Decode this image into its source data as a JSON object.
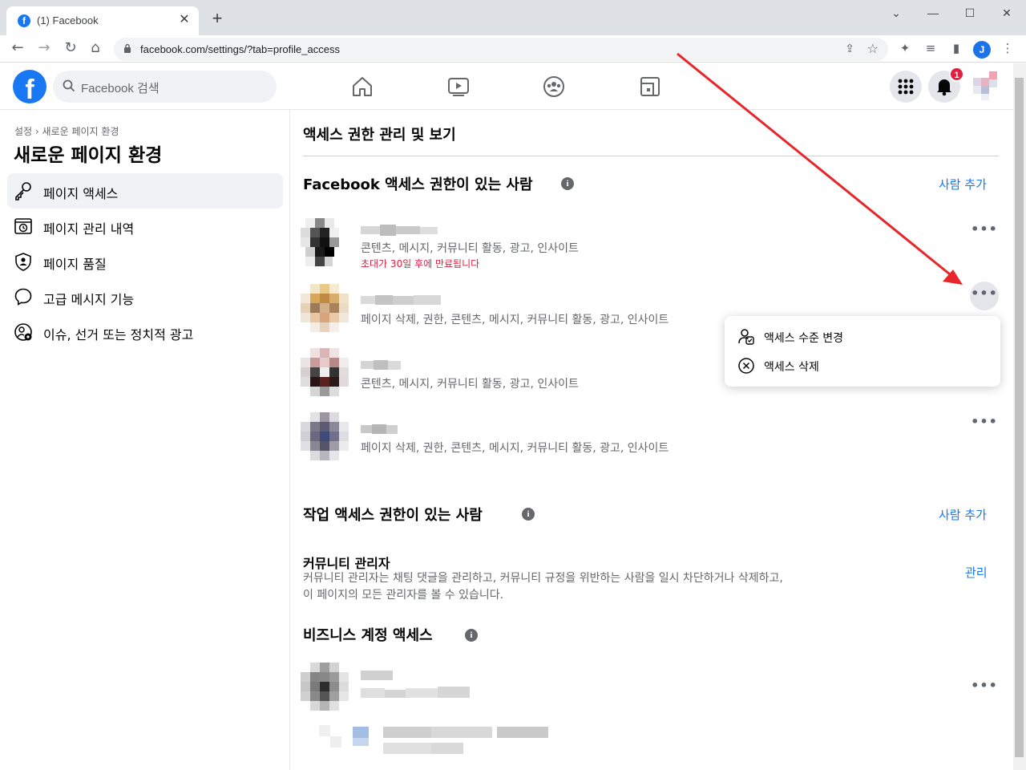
{
  "browser": {
    "tab_title": "(1) Facebook",
    "tab_close": "✕",
    "new_tab": "+",
    "url": "facebook.com/settings/?tab=profile_access",
    "profile_initial": "J",
    "window_minimize": "⌄",
    "window_min": "—",
    "window_max": "☐",
    "window_close": "✕"
  },
  "header": {
    "logo": "f",
    "search_placeholder": "Facebook 검색",
    "notification_count": "1"
  },
  "sidebar": {
    "breadcrumb": "설정 › 새로운 페이지 환경",
    "title": "새로운 페이지 환경",
    "items": [
      {
        "label": "페이지 액세스",
        "icon": "key-icon",
        "active": true
      },
      {
        "label": "페이지 관리 내역",
        "icon": "history-icon",
        "active": false
      },
      {
        "label": "페이지 품질",
        "icon": "shield-icon",
        "active": false
      },
      {
        "label": "고급 메시지 기능",
        "icon": "chat-bubble-icon",
        "active": false
      },
      {
        "label": "이슈, 선거 또는 정치적 광고",
        "icon": "person-gear-icon",
        "active": false
      }
    ]
  },
  "main": {
    "heading": "액세스 권한 관리 및 보기",
    "facebook_access": {
      "title": "Facebook 액세스 권한이 있는 사람",
      "add_link": "사람 추가",
      "people": [
        {
          "permissions": "콘텐츠, 메시지, 커뮤니티 활동, 광고, 인사이트",
          "expiry": "초대가 30일 후에 만료됩니다"
        },
        {
          "permissions": "페이지 삭제, 권한, 콘텐츠, 메시지, 커뮤니티 활동, 광고, 인사이트",
          "expiry": ""
        },
        {
          "permissions": "콘텐츠, 메시지, 커뮤니티 활동, 광고, 인사이트",
          "expiry": ""
        },
        {
          "permissions": "페이지 삭제, 권한, 콘텐츠, 메시지, 커뮤니티 활동, 광고, 인사이트",
          "expiry": ""
        }
      ],
      "more_label": "•••"
    },
    "menu": {
      "items": [
        {
          "label": "액세스 수준 변경",
          "icon": "person-edit-icon"
        },
        {
          "label": "액세스 삭제",
          "icon": "x-circle-icon"
        }
      ]
    },
    "task_access": {
      "title": "작업 액세스 권한이 있는 사람",
      "add_link": "사람 추가"
    },
    "community_manager": {
      "title": "커뮤니티 관리자",
      "description": "커뮤니티 관리자는 채팅 댓글을 관리하고, 커뮤니티 규정을 위반하는 사람을 일시 차단하거나 삭제하고, 이 페이지의 모든 관리자를 볼 수 있습니다.",
      "manage_link": "관리"
    },
    "business_access": {
      "title": "비즈니스 계정 액세스"
    }
  },
  "colors": {
    "accent": "#1877f2",
    "expiry_red": "#e41e3f",
    "annotation_arrow": "#e8252a"
  }
}
